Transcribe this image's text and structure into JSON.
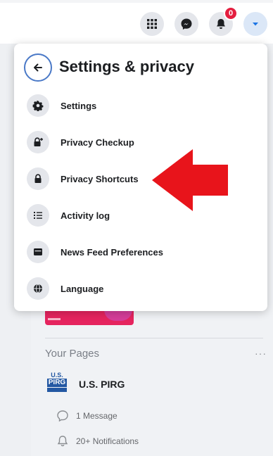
{
  "header": {
    "buttons": [
      {
        "name": "menu-grid-icon"
      },
      {
        "name": "messenger-icon"
      },
      {
        "name": "bell-icon"
      },
      {
        "name": "account-caret-icon"
      }
    ],
    "notification_badge": "0"
  },
  "menu": {
    "title": "Settings & privacy",
    "items": [
      {
        "label": "Settings",
        "icon": "gear-icon"
      },
      {
        "label": "Privacy Checkup",
        "icon": "lock-plus-icon"
      },
      {
        "label": "Privacy Shortcuts",
        "icon": "lock-icon"
      },
      {
        "label": "Activity log",
        "icon": "list-icon"
      },
      {
        "label": "News Feed Preferences",
        "icon": "feed-icon"
      },
      {
        "label": "Language",
        "icon": "globe-icon"
      }
    ]
  },
  "annotation": {
    "color": "#e8141b"
  },
  "sidebar": {
    "section_title": "Your Pages",
    "more_label": "···",
    "page": {
      "logo_top": "U.S.",
      "logo_bottom": "PIRG",
      "name": "U.S. PIRG",
      "messages": "1 Message",
      "notifications": "20+ Notifications"
    }
  },
  "colors": {
    "accent": "#4a79c7",
    "badge": "#e41e3f"
  }
}
